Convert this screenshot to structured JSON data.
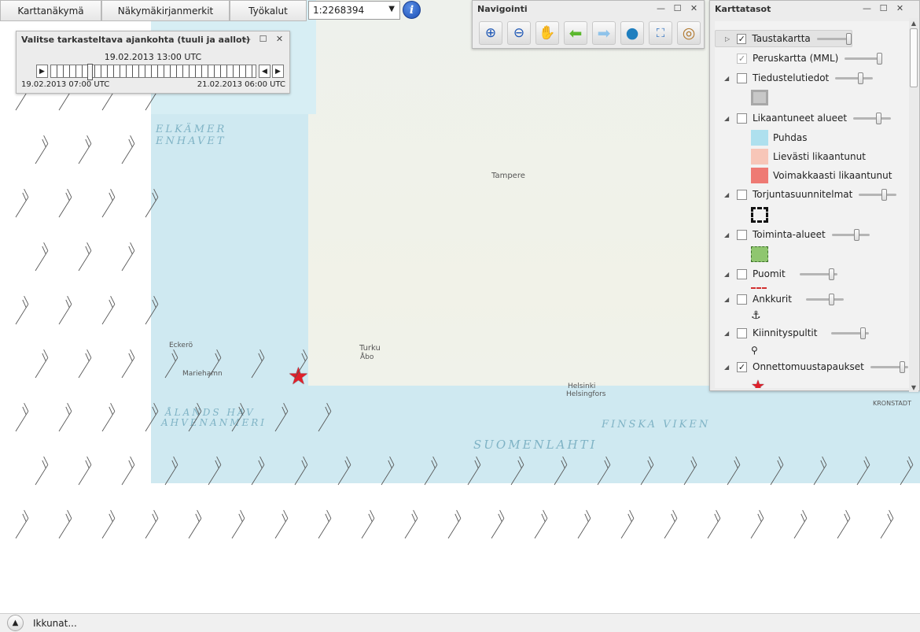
{
  "menu": {
    "items": [
      {
        "label": "Karttanäkymä"
      },
      {
        "label": "Näkymäkirjanmerkit"
      },
      {
        "label": "Työkalut"
      }
    ],
    "scale_value": "1:2268394"
  },
  "time_window": {
    "title": "Valitse tarkasteltava ajankohta (tuuli ja aallot)",
    "current": "19.02.2013 13:00 UTC",
    "start": "19.02.2013 07:00 UTC",
    "end": "21.02.2013 06:00 UTC",
    "position_fraction": 0.18
  },
  "navigation": {
    "title": "Navigointi",
    "tools": [
      "zoom-in-icon",
      "zoom-out-icon",
      "pan-hand-icon",
      "back-arrow-icon",
      "forward-arrow-icon",
      "globe-icon",
      "zoom-extent-icon",
      "target-icon"
    ]
  },
  "layers": {
    "title": "Karttatasot",
    "items": [
      {
        "label": "Taustakartta",
        "checked": true,
        "opacity": 0.9
      },
      {
        "label": "Peruskartta (MML)",
        "checked": true,
        "opacity": 1.0
      },
      {
        "label": "Tiedustelutiedot",
        "checked": false,
        "opacity": 0.7
      },
      {
        "label": "Likaantuneet alueet",
        "checked": false,
        "opacity": 0.7
      },
      {
        "label": "Torjuntasuunnitelmat",
        "checked": false,
        "opacity": 0.7
      },
      {
        "label": "Toiminta-alueet",
        "checked": false,
        "opacity": 0.7
      },
      {
        "label": "Puomit",
        "checked": false,
        "opacity": 0.9
      },
      {
        "label": "Ankkurit",
        "checked": false,
        "opacity": 0.7
      },
      {
        "label": "Kiinnityspultit",
        "checked": false,
        "opacity": 0.9
      },
      {
        "label": "Onnettomuustapaukset",
        "checked": true,
        "opacity": 0.9
      }
    ],
    "legend": {
      "puhdas": "Puhdas",
      "lievasti": "Lievästi likaantunut",
      "voimakkaasti": "Voimakkaasti likaantunut"
    },
    "colors": {
      "puhdas": "#aee0ee",
      "lievasti": "#f7c6b8",
      "voimakkaasti": "#ee7a74",
      "toiminta": "#8fc66f",
      "puomit": "#d23030"
    }
  },
  "map": {
    "labels": [
      {
        "text": "ELKÄMER",
        "cls": "sea"
      },
      {
        "text": "ENHAVET",
        "cls": "sea"
      },
      {
        "text": "ÅLANDS HAV",
        "cls": "sea"
      },
      {
        "text": "AHVENANMERI",
        "cls": "sea"
      },
      {
        "text": "SUOMENLAHTI",
        "cls": "sea"
      },
      {
        "text": "FINSKA VIKEN",
        "cls": "sea"
      },
      {
        "text": "Tampere",
        "cls": "city"
      },
      {
        "text": "Turku",
        "cls": "city"
      },
      {
        "text": "Åbo",
        "cls": "city"
      },
      {
        "text": "Helsinki",
        "cls": "city"
      },
      {
        "text": "Helsingfors",
        "cls": "city"
      },
      {
        "text": "KRONSTADT",
        "cls": "city"
      },
      {
        "text": "Eckerö",
        "cls": "city"
      },
      {
        "text": "Mariehamn",
        "cls": "city"
      }
    ]
  },
  "bottom": {
    "windows_label": "Ikkunat..."
  }
}
